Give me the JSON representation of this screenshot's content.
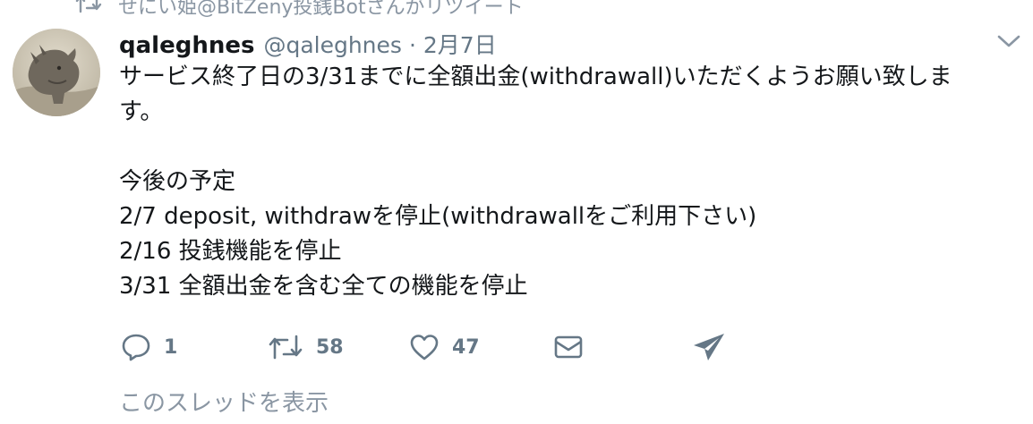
{
  "retweet_context": {
    "text": "せにい姫@BitZeny投銭Botさんがリツイート",
    "icon": "retweet-icon"
  },
  "tweet": {
    "avatar": "rhinoceros-avatar",
    "author_name": "qaleghnes",
    "author_handle": "@qaleghnes",
    "separator": "·",
    "date": "2月7日",
    "menu_icon": "chevron-down-icon",
    "text_lines": {
      "l1": "サービス終了日の3/31までに全額出金(withdrawall)いただくようお願い致しま",
      "l2": "す。",
      "l4": "今後の予定",
      "l5": "2/7 deposit, withdrawを停止(withdrawallをご利用下さい)",
      "l6": "2/16 投銭機能を停止",
      "l7": "3/31 全額出金を含む全ての機能を停止"
    },
    "actions": {
      "reply_count": "1",
      "retweet_count": "58",
      "like_count": "47"
    },
    "thread_link": "このスレッドを表示"
  },
  "colors": {
    "text": "#14171a",
    "secondary": "#657786",
    "muted": "#8a96a3",
    "background": "#ffffff"
  }
}
